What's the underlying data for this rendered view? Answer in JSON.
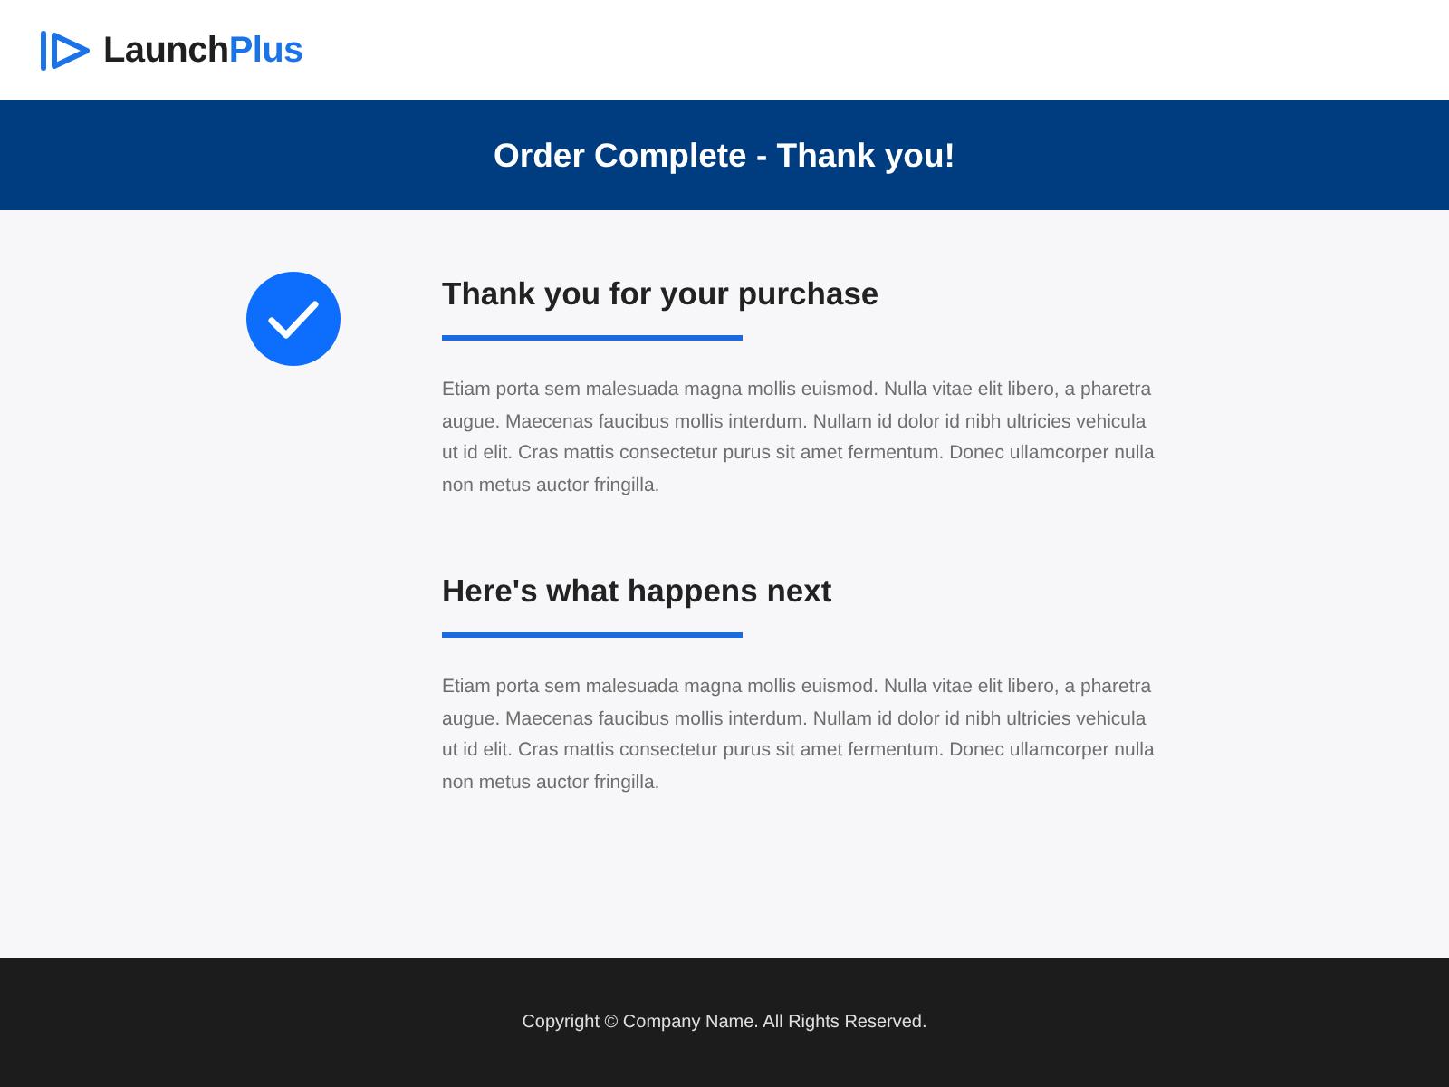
{
  "header": {
    "logo": {
      "name_main": "Launch",
      "name_accent": "Plus"
    }
  },
  "banner": {
    "title": "Order Complete - Thank you!"
  },
  "sections": [
    {
      "heading": "Thank you for your purchase",
      "body": "Etiam porta sem malesuada magna mollis euismod. Nulla vitae elit libero, a pharetra augue. Maecenas faucibus mollis interdum. Nullam id dolor id nibh ultricies vehicula ut id elit. Cras mattis consectetur purus sit amet fermentum. Donec ullamcorper nulla non metus auctor fringilla."
    },
    {
      "heading": "Here's what happens next",
      "body": "Etiam porta sem malesuada magna mollis euismod. Nulla vitae elit libero, a pharetra augue. Maecenas faucibus mollis interdum. Nullam id dolor id nibh ultricies vehicula ut id elit. Cras mattis consectetur purus sit amet fermentum. Donec ullamcorper nulla non metus auctor fringilla."
    }
  ],
  "footer": {
    "copyright": "Copyright © Company Name. All Rights Reserved."
  }
}
